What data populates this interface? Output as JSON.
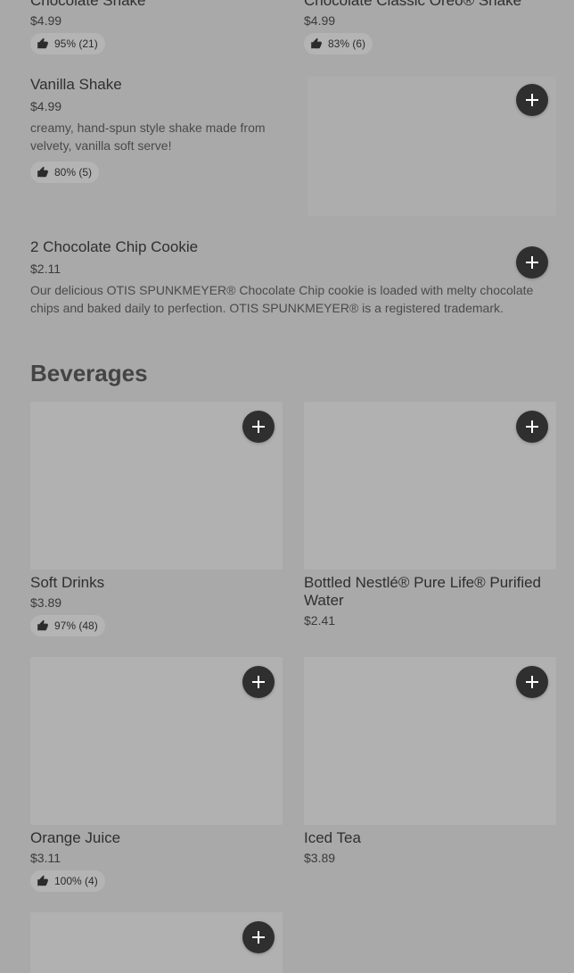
{
  "top_row": [
    {
      "name": "Chocolate Shake",
      "price": "$4.99",
      "rating": "95% (21)"
    },
    {
      "name": "Chocolate Classic Oreo® Shake",
      "price": "$4.99",
      "rating": "83% (6)"
    }
  ],
  "vanilla": {
    "name": "Vanilla Shake",
    "price": "$4.99",
    "desc": "creamy, hand-spun style shake made from velvety, vanilla soft serve!",
    "rating": "80% (5)"
  },
  "cookie": {
    "name": "2 Chocolate Chip Cookie",
    "price": "$2.11",
    "desc": "Our delicious OTIS SPUNKMEYER® Chocolate Chip cookie is loaded with melty chocolate chips and baked daily to perfection. OTIS SPUNKMEYER® is a registered trademark."
  },
  "beverages": {
    "title": "Beverages",
    "items": [
      {
        "name": "Soft Drinks",
        "price": "$3.89",
        "rating": "97% (48)"
      },
      {
        "name": "Bottled Nestlé® Pure Life® Purified Water",
        "price": "$2.41",
        "rating": ""
      },
      {
        "name": "Orange Juice",
        "price": "$3.11",
        "rating": "100% (4)"
      },
      {
        "name": "Iced Tea",
        "price": "$3.89",
        "rating": ""
      }
    ]
  },
  "icons": {
    "add": "plus-icon",
    "rating": "thumbs-up-icon"
  },
  "colors": {
    "background": "#a9a9a9",
    "add_button": "#2f2f2f",
    "placeholder": "#b1b1b1"
  }
}
